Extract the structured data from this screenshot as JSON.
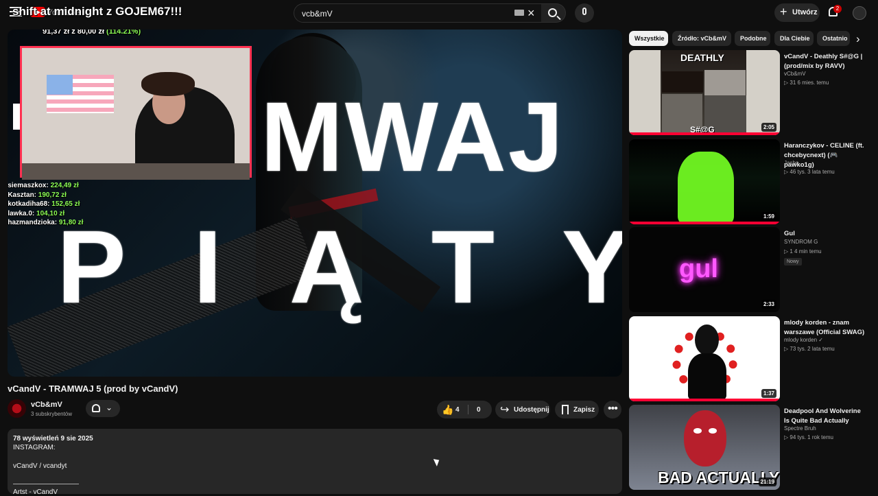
{
  "header": {
    "logo_text": "YouTube",
    "stream_overlay_title": "shift at midnight z GOJEM67!!!",
    "search_value": "vcb&mV",
    "create_label": "Utwórz",
    "notifications_count": "2"
  },
  "player": {
    "goal": {
      "current": "91,37 zł",
      "separator": "z",
      "target": "80,00 zł",
      "percent": "(114.21%)"
    },
    "leaderboard": [
      {
        "rank_name": "1.siemaszkox:",
        "amount": "224,49 zł"
      },
      {
        "rank_name": "2.Kasztan:",
        "amount": "190,72 zł"
      },
      {
        "rank_name": "3.kotkadiha68:",
        "amount": "152,65 zł"
      },
      {
        "rank_name": "4.lawka.0:",
        "amount": "104,10 zł"
      },
      {
        "rank_name": "5.hazmandzioka:",
        "amount": "91,80 zł"
      }
    ],
    "big_text_top": "MWAJ",
    "big_text_bottom": "PIĄTY"
  },
  "video": {
    "title": "vCandV - TRAMWAJ 5 (prod by vCandV)",
    "channel_name": "vCb&mV",
    "subscribers": "3 subskrybentów",
    "likes": "4",
    "dislikes": "0",
    "share_label": "Udostępnij",
    "save_label": "Zapisz",
    "description": {
      "stats": "78 wyświetleń  9 sie 2025",
      "lines": [
        "INSTAGRAM:",
        "vCandV   / vcandyt",
        "Artst - vCandV"
      ]
    }
  },
  "sidebar": {
    "chips": [
      "Wszystkie",
      "Źródło: vCb&mV",
      "Podobne",
      "Dla Ciebie",
      "Ostatnio"
    ],
    "recommendations": [
      {
        "title": "vCandV - Deathly S#@G | (prod/mix by RAVV)",
        "channel": "vCb&mV",
        "meta": "▷ 31   6 mies. temu",
        "duration": "2:05",
        "thumb_top": "DEATHLY",
        "thumb_bottom": "S#@G"
      },
      {
        "title": "Haranczykov - CELINE (ft. chcebycnext) (🎮 pawko1g)",
        "channel": "Jasho",
        "meta": "▷ 46 tys.   3 lata temu",
        "duration": "1:59"
      },
      {
        "title": "Gul",
        "channel": "SYNDROM G",
        "meta": "▷ 1   4 min temu",
        "badge": "Nowy",
        "duration": "2:33",
        "thumb_word": "gul"
      },
      {
        "title": "mlody korden - znam warszawe (Official SWAG)",
        "channel": "mlody korden ✓",
        "meta": "▷ 73 tys.   2 lata temu",
        "duration": "1:37"
      },
      {
        "title": "Deadpool And Wolverine Is Quite Bad Actually",
        "channel": "Spectre Bruh",
        "meta": "▷ 94 tys.   1 rok temu",
        "duration": "21:19",
        "thumb_caption": "BAD ACTUALLY"
      }
    ]
  }
}
